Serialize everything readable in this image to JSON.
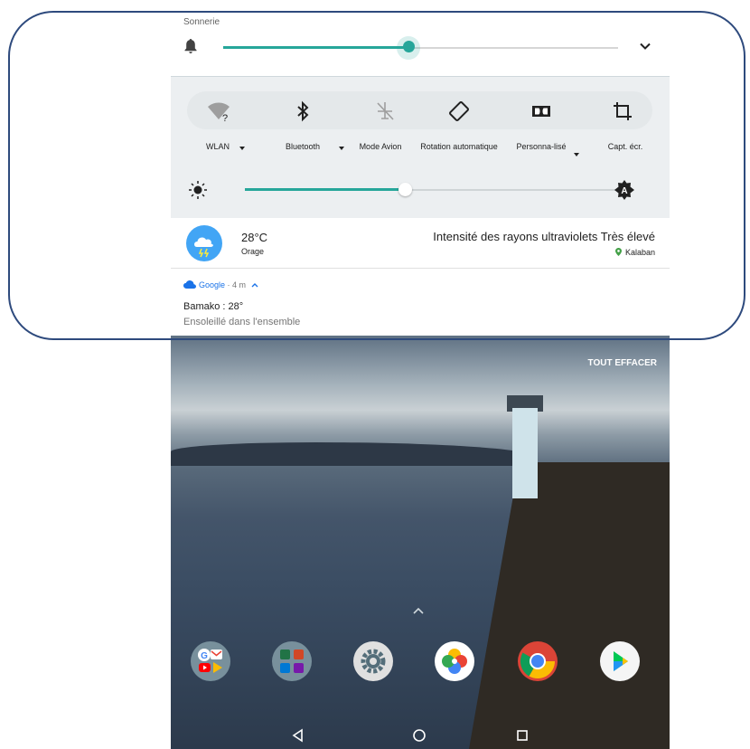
{
  "volume": {
    "title": "Sonnerie",
    "level_percent": 47
  },
  "quick_settings": {
    "tiles": [
      {
        "label": "WLAN",
        "icon": "wifi-unknown-icon",
        "dropdown": true
      },
      {
        "label": "Bluetooth",
        "icon": "bluetooth-icon",
        "dropdown": true
      },
      {
        "label": "Mode Avion",
        "icon": "airplane-off-icon",
        "dropdown": false
      },
      {
        "label": "Rotation automatique",
        "icon": "auto-rotate-icon",
        "dropdown": false
      },
      {
        "label": "Personna-lisé",
        "icon": "dolby-icon",
        "dropdown": true
      },
      {
        "label": "Capt. écr.",
        "icon": "crop-icon",
        "dropdown": false
      }
    ],
    "brightness_percent": 43
  },
  "weather": {
    "temperature": "28°C",
    "condition": "Orage",
    "uv_text": "Intensité des rayons ultraviolets",
    "uv_level": "Très élevé",
    "location": "Kalaban"
  },
  "notification": {
    "app": "Google",
    "time": "· 4 m",
    "title": "Bamako : 28°",
    "text": "Ensoleillé dans l'ensemble"
  },
  "clear_all": "TOUT EFFACER",
  "dock": [
    "google-folder-icon",
    "office-folder-icon",
    "settings-icon",
    "photos-icon",
    "chrome-icon",
    "play-store-icon"
  ],
  "nav": [
    "back-icon",
    "home-icon",
    "recents-icon"
  ],
  "colors": {
    "accent": "#26a69a",
    "link": "#1a73e8",
    "frame": "#2e4a7d"
  }
}
